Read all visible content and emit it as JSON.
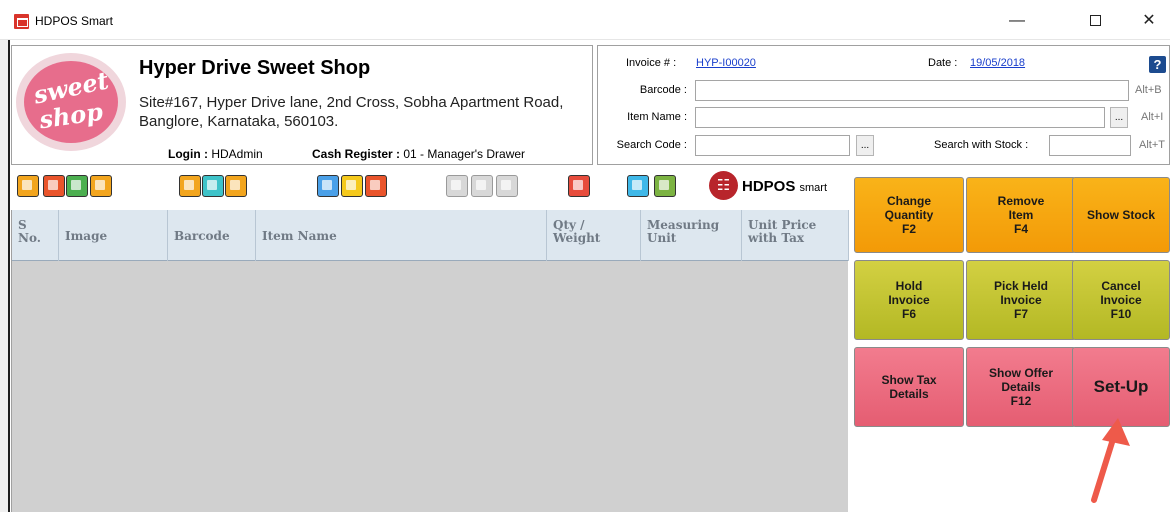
{
  "window": {
    "title": "HDPOS Smart",
    "minimize": "—",
    "close": "✕"
  },
  "shop": {
    "logo_line1": "sweet",
    "logo_line2": "shop",
    "name": "Hyper Drive Sweet Shop",
    "address": "Site#167, Hyper Drive lane, 2nd Cross, Sobha Apartment Road, Banglore, Karnataka, 560103.",
    "login_label": "Login :",
    "login_value": "HDAdmin",
    "cash_label": "Cash Register :",
    "cash_value": "01 - Manager's Drawer"
  },
  "invoice": {
    "invoice_label": "Invoice # :",
    "invoice_value": "HYP-I00020",
    "date_label": "Date :",
    "date_value": "19/05/2018",
    "help": "?",
    "barcode_label": "Barcode :",
    "barcode_hotkey": "Alt+B",
    "item_name_label": "Item Name :",
    "item_name_hotkey": "Alt+I",
    "search_code_label": "Search Code :",
    "search_stock_label": "Search with Stock :",
    "search_stock_hotkey": "Alt+T",
    "ellipsis": "..."
  },
  "toolbar": {
    "brand_text": "HDPOS",
    "brand_small": "smart",
    "icons": [
      {
        "name": "open-icon",
        "color": "#f2a51e"
      },
      {
        "name": "calculator-icon",
        "color": "#e9542b"
      },
      {
        "name": "report-icon",
        "color": "#4caf50"
      },
      {
        "name": "document-icon",
        "color": "#f2a51e"
      },
      {
        "name": "edit-list-icon",
        "color": "#f2a51e"
      },
      {
        "name": "cart-icon",
        "color": "#3ec3c9"
      },
      {
        "name": "person-add-icon",
        "color": "#f2a51e"
      },
      {
        "name": "puzzle-icon",
        "color": "#4aa0e8"
      },
      {
        "name": "note-edit-icon",
        "color": "#f5c91c"
      },
      {
        "name": "return-icon",
        "color": "#e9542b"
      },
      {
        "name": "list-disabled-icon",
        "color": "#d8d8d8"
      },
      {
        "name": "coin-disabled-icon",
        "color": "#d8d8d8"
      },
      {
        "name": "cancel-disabled-icon",
        "color": "#d8d8d8"
      },
      {
        "name": "apps-icon",
        "color": "#e74c3c"
      },
      {
        "name": "user-icon",
        "color": "#3fb8e8"
      },
      {
        "name": "settings-gear-icon",
        "color": "#7cb342"
      }
    ]
  },
  "grid": {
    "columns": [
      {
        "name": "col-sno",
        "label": "S\nNo."
      },
      {
        "name": "col-image",
        "label": "Image"
      },
      {
        "name": "col-barcode",
        "label": "Barcode"
      },
      {
        "name": "col-item-name",
        "label": "Item Name"
      },
      {
        "name": "col-qty",
        "label": "Qty /\nWeight"
      },
      {
        "name": "col-unit",
        "label": "Measuring\nUnit"
      },
      {
        "name": "col-price",
        "label": "Unit Price\nwith Tax"
      }
    ]
  },
  "buttons": {
    "change_quantity": "Change\nQuantity\nF2",
    "remove_item": "Remove\nItem\nF4",
    "show_stock": "Show Stock",
    "hold_invoice": "Hold\nInvoice\nF6",
    "pick_held": "Pick Held\nInvoice\nF7",
    "cancel_invoice": "Cancel\nInvoice\nF10",
    "show_tax": "Show Tax\nDetails",
    "show_offer": "Show Offer\nDetails\nF12",
    "setup": "Set-Up"
  },
  "colors": {
    "orange": "#f5a20e",
    "olive": "#c4c430",
    "pink": "#ea6a7e",
    "arrow": "#ee5a4a"
  }
}
